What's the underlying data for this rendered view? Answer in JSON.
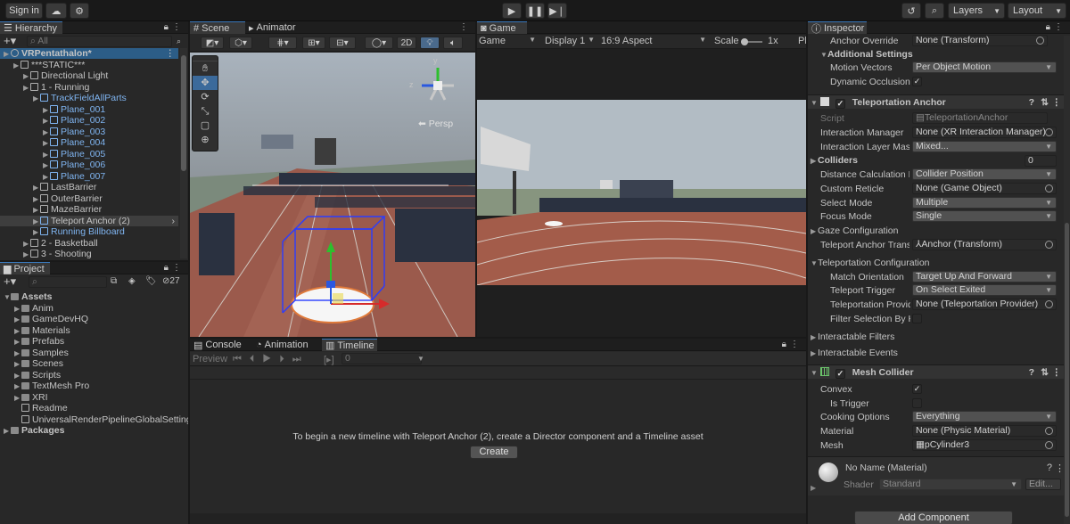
{
  "toolbar": {
    "sign_in": "Sign in",
    "layers": "Layers",
    "layout": "Layout"
  },
  "hierarchy": {
    "tab": "Hierarchy",
    "search_placeholder": "All",
    "rows": [
      {
        "label": "VRPentathalon*",
        "indent": 0,
        "icon": "unity",
        "bold": true,
        "sel": true
      },
      {
        "label": "***STATIC***",
        "indent": 1,
        "icon": "cube"
      },
      {
        "label": "Directional Light",
        "indent": 2,
        "icon": "cube"
      },
      {
        "label": "1 - Running",
        "indent": 2,
        "icon": "cube"
      },
      {
        "label": "TrackFieldAllParts",
        "indent": 3,
        "icon": "cubeb",
        "blue": true
      },
      {
        "label": "Plane_001",
        "indent": 4,
        "icon": "cubeb",
        "blue": true
      },
      {
        "label": "Plane_002",
        "indent": 4,
        "icon": "cubeb",
        "blue": true
      },
      {
        "label": "Plane_003",
        "indent": 4,
        "icon": "cubeb",
        "blue": true
      },
      {
        "label": "Plane_004",
        "indent": 4,
        "icon": "cubeb",
        "blue": true
      },
      {
        "label": "Plane_005",
        "indent": 4,
        "icon": "cubeb",
        "blue": true
      },
      {
        "label": "Plane_006",
        "indent": 4,
        "icon": "cubeb",
        "blue": true
      },
      {
        "label": "Plane_007",
        "indent": 4,
        "icon": "cubeb",
        "blue": true
      },
      {
        "label": "LastBarrier",
        "indent": 3,
        "icon": "cube"
      },
      {
        "label": "OuterBarrier",
        "indent": 3,
        "icon": "cube"
      },
      {
        "label": "MazeBarrier",
        "indent": 3,
        "icon": "cube"
      },
      {
        "label": "Teleport Anchor (2)",
        "indent": 3,
        "icon": "cubeb",
        "hover": true
      },
      {
        "label": "Running Billboard",
        "indent": 3,
        "icon": "cubeb",
        "blue": true
      },
      {
        "label": "2 - Basketball",
        "indent": 2,
        "icon": "cube"
      },
      {
        "label": "3 - Shooting",
        "indent": 2,
        "icon": "cube"
      }
    ]
  },
  "project": {
    "tab": "Project",
    "count": "27",
    "rows": [
      {
        "label": "Assets",
        "indent": 0,
        "bold": true
      },
      {
        "label": "Anim",
        "indent": 1
      },
      {
        "label": "GameDevHQ",
        "indent": 1
      },
      {
        "label": "Materials",
        "indent": 1
      },
      {
        "label": "Prefabs",
        "indent": 1
      },
      {
        "label": "Samples",
        "indent": 1
      },
      {
        "label": "Scenes",
        "indent": 1
      },
      {
        "label": "Scripts",
        "indent": 1
      },
      {
        "label": "TextMesh Pro",
        "indent": 1
      },
      {
        "label": "XRI",
        "indent": 1
      },
      {
        "label": "Readme",
        "indent": 1,
        "file": true
      },
      {
        "label": "UniversalRenderPipelineGlobalSettings",
        "indent": 1,
        "file": true
      },
      {
        "label": "Packages",
        "indent": 0,
        "bold": true
      }
    ]
  },
  "scene": {
    "tab_scene": "Scene",
    "tab_animator": "Animator",
    "mode_2d": "2D",
    "persp": "Persp",
    "gizmo_y": "y",
    "gizmo_z": "z"
  },
  "game": {
    "tab": "Game",
    "mode": "Game",
    "display": "Display 1",
    "aspect": "16:9 Aspect",
    "scale_label": "Scale",
    "scale_value": "1x",
    "play_focused": "Pl"
  },
  "bottom": {
    "tab_console": "Console",
    "tab_animation": "Animation",
    "tab_timeline": "Timeline",
    "preview": "Preview",
    "frame": "0",
    "message": "To begin a new timeline with Teleport Anchor (2), create a Director component and a Timeline asset",
    "create": "Create"
  },
  "inspector": {
    "tab": "Inspector",
    "anchor_override_label": "Anchor Override",
    "anchor_override_value": "None (Transform)",
    "additional_settings": "Additional Settings",
    "motion_vectors_label": "Motion Vectors",
    "motion_vectors_value": "Per Object Motion",
    "dynamic_occlusion_label": "Dynamic Occlusion",
    "teleport_anchor_title": "Teleportation Anchor",
    "script_label": "Script",
    "script_value": "TeleportationAnchor",
    "interaction_manager_label": "Interaction Manager",
    "interaction_manager_value": "None (XR Interaction Manager)",
    "interaction_layer_label": "Interaction Layer Mask",
    "interaction_layer_value": "Mixed...",
    "colliders_label": "Colliders",
    "colliders_value": "0",
    "distance_calc_label": "Distance Calculation M",
    "distance_calc_value": "Collider Position",
    "custom_reticle_label": "Custom Reticle",
    "custom_reticle_value": "None (Game Object)",
    "select_mode_label": "Select Mode",
    "select_mode_value": "Multiple",
    "focus_mode_label": "Focus Mode",
    "focus_mode_value": "Single",
    "gaze_config_label": "Gaze Configuration",
    "anchor_transform_label": "Teleport Anchor Transfo",
    "anchor_transform_value": "Anchor (Transform)",
    "teleport_config_label": "Teleportation Configuration",
    "match_orientation_label": "Match Orientation",
    "match_orientation_value": "Target Up And Forward",
    "teleport_trigger_label": "Teleport Trigger",
    "teleport_trigger_value": "On Select Exited",
    "teleport_provider_label": "Teleportation Provid",
    "teleport_provider_value": "None (Teleportation Provider)",
    "filter_selection_label": "Filter Selection By H",
    "interactable_filters_label": "Interactable Filters",
    "interactable_events_label": "Interactable Events",
    "mesh_collider_title": "Mesh Collider",
    "convex_label": "Convex",
    "is_trigger_label": "Is Trigger",
    "cooking_label": "Cooking Options",
    "cooking_value": "Everything",
    "material_label": "Material",
    "material_value": "None (Physic Material)",
    "mesh_label": "Mesh",
    "mesh_value": "pCylinder3",
    "no_name_material": "No Name (Material)",
    "shader_label": "Shader",
    "shader_value": "Standard",
    "edit": "Edit...",
    "add_component": "Add Component"
  }
}
